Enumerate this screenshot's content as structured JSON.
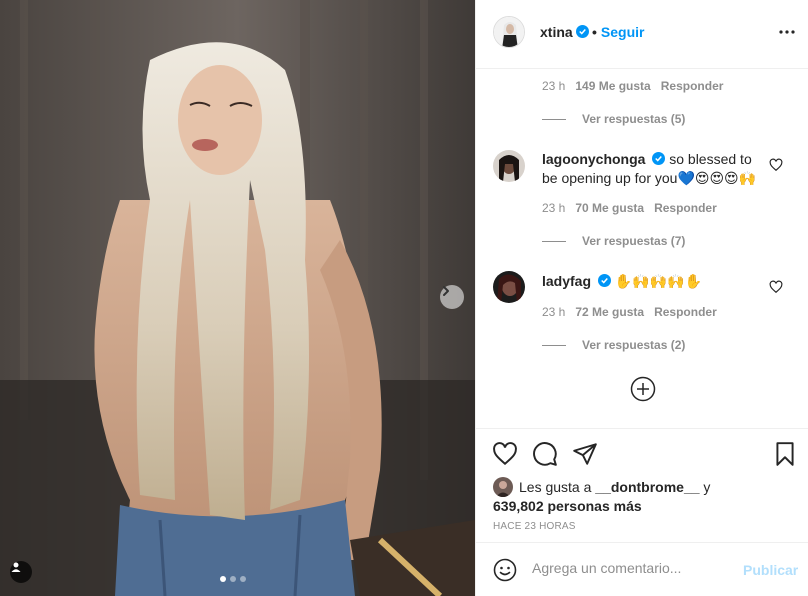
{
  "post": {
    "username": "xtina",
    "follow_label": "Seguir",
    "dot_separator": "•",
    "verified_color": "#0095f6",
    "more_icon": "ellipsis-icon"
  },
  "comments": {
    "top_meta": {
      "time": "23 h",
      "likes": "149 Me gusta",
      "reply": "Responder"
    },
    "top_view_replies": "Ver respuestas (5)",
    "items": [
      {
        "username": "lagoonychonga",
        "text": "so blessed to be opening up for you💙😍😍😍🙌",
        "time": "23 h",
        "likes": "70 Me gusta",
        "reply": "Responder",
        "view_replies": "Ver respuestas (7)"
      },
      {
        "username": "ladyfag",
        "text": "✋🙌🙌🙌✋",
        "time": "23 h",
        "likes": "72 Me gusta",
        "reply": "Responder",
        "view_replies": "Ver respuestas (2)"
      }
    ]
  },
  "likes": {
    "prefix": "Les gusta a",
    "user": "__dontbrome__",
    "suffix": "y",
    "count": "639,802",
    "count_suffix": "personas más"
  },
  "timestamp": "HACE 23 HORAS",
  "add_comment": {
    "placeholder": "Agrega un comentario...",
    "publish_label": "Publicar"
  },
  "carousel": {
    "slides": 3,
    "active": 1
  }
}
